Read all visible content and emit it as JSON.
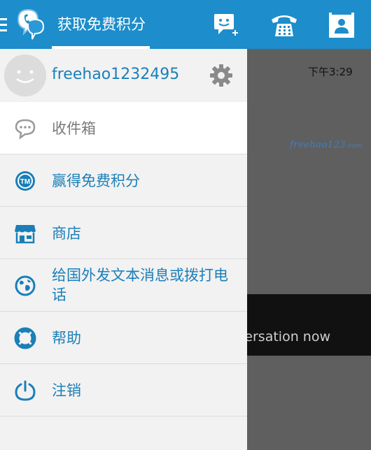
{
  "topbar": {
    "title": "获取免费积分",
    "icons": [
      "menu-icon",
      "app-logo-icon",
      "new-message-icon",
      "phone-dialpad-icon",
      "contacts-icon"
    ],
    "color": "#1d8dcb"
  },
  "background": {
    "time": "下午3:29",
    "watermark": "freehao123",
    "watermark_sub": ".com",
    "conversation_hint": "Start a conversation now"
  },
  "drawer": {
    "account": {
      "username": "freehao1232495",
      "icon": "settings-gear-icon"
    },
    "items": [
      {
        "label": "收件箱",
        "icon": "chat-bubble-icon"
      },
      {
        "label": "赢得免费积分",
        "icon": "tm-credits-icon"
      },
      {
        "label": "商店",
        "icon": "store-icon"
      },
      {
        "label": "给国外发文本消息或拨打电话",
        "icon": "globe-icon"
      },
      {
        "label": "帮助",
        "icon": "lifebuoy-icon"
      },
      {
        "label": "注销",
        "icon": "power-icon"
      }
    ]
  },
  "colors": {
    "accent": "#1a7fb8",
    "drawer_bg": "#f2f2f2",
    "inbox_bg": "#ffffff"
  }
}
